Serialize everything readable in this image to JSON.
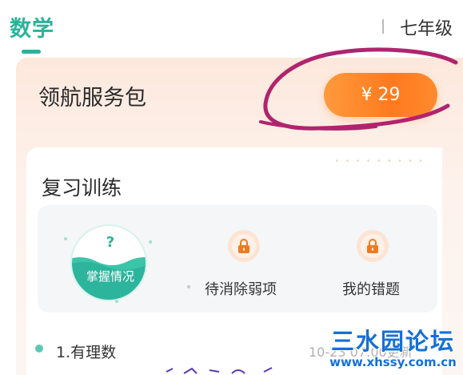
{
  "header": {
    "subject_tab": "数学",
    "grade": "七年级"
  },
  "package": {
    "title": "领航服务包",
    "price": "¥ 29"
  },
  "review": {
    "title": "复习训练",
    "mastery": {
      "icon": "question-mark",
      "symbol": "?",
      "label": "掌握情况"
    },
    "features": [
      {
        "label": "待消除弱项",
        "icon": "lock-icon"
      },
      {
        "label": "我的错题",
        "icon": "lock-icon"
      }
    ]
  },
  "chapters": [
    {
      "title": "1.有理数",
      "date": "10-23 07:00更新"
    }
  ],
  "watermark": {
    "main": "三水园论坛",
    "url": "www.xhssy.com.cn"
  },
  "colors": {
    "accent": "#2bb39a",
    "price_orange": "#ff7a1f",
    "annotation_magenta": "#b0246e",
    "watermark_blue": "#1670d6"
  }
}
